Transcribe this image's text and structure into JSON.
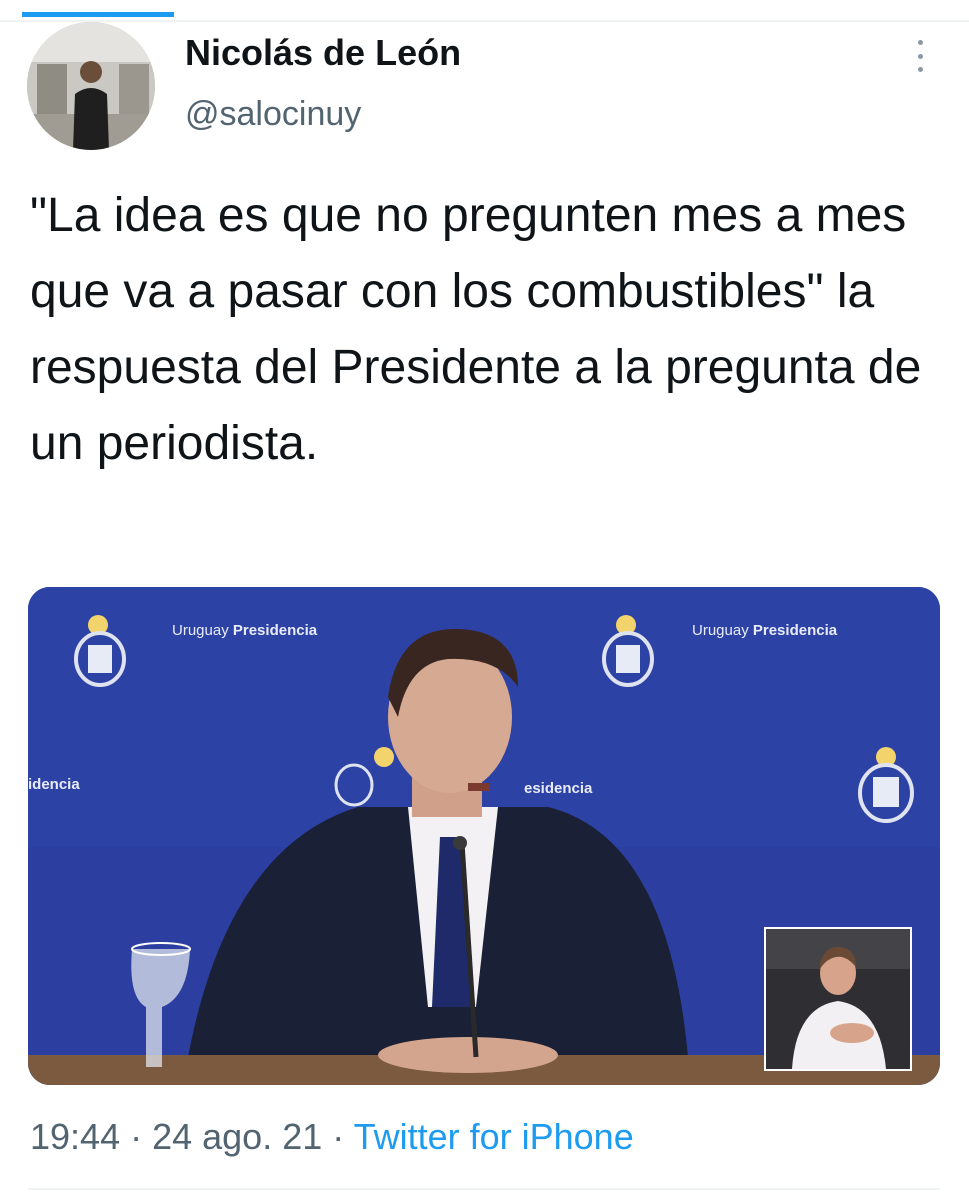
{
  "author": {
    "name": "Nicolás de León",
    "handle": "@salocinuy"
  },
  "tweet": {
    "text": "\"La idea es que no pregunten mes a mes que va a pasar con los combustibles\" la respuesta del Presidente a la pregunta de un periodista."
  },
  "media": {
    "backdrop_label_brand": "Uruguay",
    "backdrop_label_word": "Presidencia",
    "backdrop_fragment_left": "idencia",
    "backdrop_fragment_center": "esidencia"
  },
  "footer": {
    "time": "19:44",
    "separator_1": " · ",
    "date": "24 ago. 21",
    "separator_2": " · ",
    "source": "Twitter for iPhone"
  },
  "colors": {
    "link": "#1d9bf0",
    "secondary_text": "#536471",
    "backdrop_blue": "#2c3fa0"
  },
  "icons": [
    "more-vertical-icon",
    "avatar"
  ]
}
